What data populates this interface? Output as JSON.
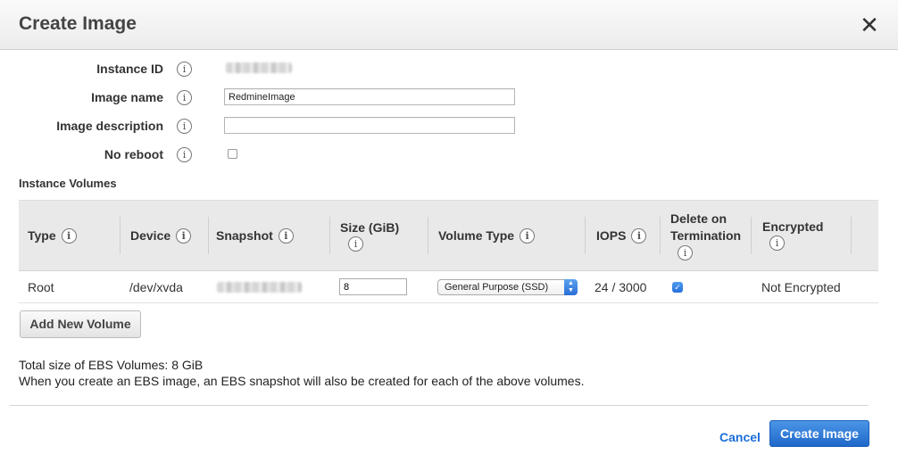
{
  "dialog": {
    "title": "Create Image",
    "close_label": "✕"
  },
  "form": {
    "instance_id_label": "Instance ID",
    "image_name_label": "Image name",
    "image_name_value": "RedmineImage",
    "image_description_label": "Image description",
    "image_description_value": "",
    "no_reboot_label": "No reboot",
    "no_reboot_checked": false,
    "info_glyph": "i"
  },
  "volumes": {
    "section_title": "Instance Volumes",
    "columns": {
      "type": "Type",
      "device": "Device",
      "snapshot": "Snapshot",
      "size": "Size (GiB)",
      "volume_type": "Volume Type",
      "iops": "IOPS",
      "delete_on_termination_line1": "Delete on",
      "delete_on_termination_line2": "Termination",
      "encrypted": "Encrypted"
    },
    "rows": [
      {
        "type": "Root",
        "device": "/dev/xvda",
        "size": "8",
        "volume_type": "General Purpose (SSD)",
        "iops": "24 / 3000",
        "delete_on_termination": true,
        "encrypted": "Not Encrypted"
      }
    ],
    "add_button": "Add New Volume"
  },
  "notes": {
    "total_size": "Total size of EBS Volumes: 8 GiB",
    "snapshot_note": "When you create an EBS image, an EBS snapshot will also be created for each of the above volumes."
  },
  "footer": {
    "cancel": "Cancel",
    "create": "Create Image"
  },
  "colors": {
    "primary_button": "#2a74d2",
    "link": "#1a6ed8",
    "header_bg": "#efefef",
    "table_header_bg": "#e9e9e9"
  }
}
